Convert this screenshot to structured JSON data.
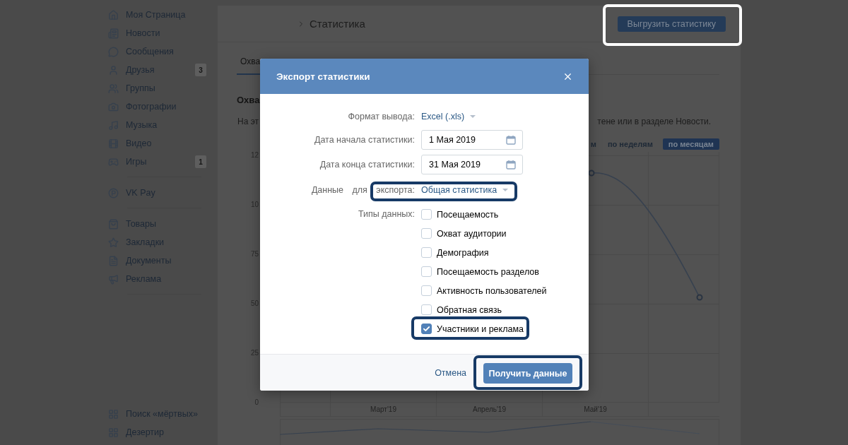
{
  "sidebar": {
    "sections": [
      {
        "items": [
          {
            "label": "Моя Страница"
          },
          {
            "label": "Новости"
          },
          {
            "label": "Сообщения"
          },
          {
            "label": "Друзья",
            "badge": "3"
          },
          {
            "label": "Группы"
          },
          {
            "label": "Фотографии"
          },
          {
            "label": "Музыка"
          },
          {
            "label": "Видео"
          },
          {
            "label": "Игры",
            "badge": "1"
          }
        ]
      },
      {
        "items": [
          {
            "label": "VK Pay"
          }
        ]
      },
      {
        "items": [
          {
            "label": "Товары"
          },
          {
            "label": "Закладки"
          },
          {
            "label": "Документы"
          },
          {
            "label": "Реклама"
          }
        ]
      }
    ],
    "bottom_items": [
      {
        "label": "Поиск «мёртвых»"
      },
      {
        "label": "Дезертир"
      }
    ]
  },
  "page": {
    "breadcrumb": "Статистика",
    "export_button": {
      "label": "Выгрузить статистику",
      "highlighted": true
    },
    "tabs": [
      {
        "label": "Охва",
        "selected": true
      }
    ],
    "heading": "Охва",
    "description_start": "На эт",
    "description_end": "тене или в разделе Новости.",
    "period_options": [
      {
        "label": "м",
        "selected": false
      },
      {
        "label": "по неделям",
        "selected": false
      },
      {
        "label": "по месяцам",
        "selected": true
      }
    ],
    "chart": {
      "y_labels": [
        "12",
        "10",
        "75",
        "50",
        "25",
        "0"
      ],
      "x_labels": [
        "Март'19",
        "Апрель'19",
        "Май'19"
      ]
    }
  },
  "modal": {
    "title": "Экспорт статистики",
    "fields": [
      {
        "kind": "dropdown",
        "label": "Формат вывода:",
        "value": "Excel (.xls)",
        "highlighted": false
      },
      {
        "kind": "date",
        "label": "Дата начала статистики:",
        "value": "1 Мая 2019",
        "highlighted": false
      },
      {
        "kind": "date",
        "label": "Дата конца статистики:",
        "value": "31 Мая 2019",
        "highlighted": false
      },
      {
        "kind": "dropdown",
        "label": "Данные для экспорта:",
        "value": "Общая статистика",
        "highlighted": true
      }
    ],
    "data_types_label": "Типы данных:",
    "data_types": [
      {
        "label": "Посещаемость",
        "checked": false,
        "highlighted": false
      },
      {
        "label": "Охват аудитории",
        "checked": false,
        "highlighted": false
      },
      {
        "label": "Демография",
        "checked": false,
        "highlighted": false
      },
      {
        "label": "Посещаемость разделов",
        "checked": false,
        "highlighted": false
      },
      {
        "label": "Активность пользователей",
        "checked": false,
        "highlighted": false
      },
      {
        "label": "Обратная связь",
        "checked": false,
        "highlighted": false
      },
      {
        "label": "Участники и реклама",
        "checked": true,
        "highlighted": true
      }
    ],
    "cancel": "Отмена",
    "submit": {
      "label": "Получить данные",
      "highlighted": true
    }
  }
}
